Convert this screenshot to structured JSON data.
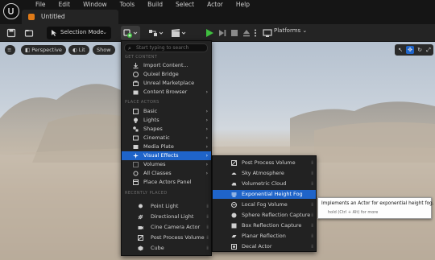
{
  "menubar": [
    "File",
    "Edit",
    "Window",
    "Tools",
    "Build",
    "Select",
    "Actor",
    "Help"
  ],
  "document_tab": "Untitled",
  "toolbar": {
    "mode_label": "Selection Mode",
    "platforms_label": "Platforms"
  },
  "viewport": {
    "perspective": "Perspective",
    "lit": "Lit",
    "show": "Show"
  },
  "add_menu": {
    "search_placeholder": "Start typing to search",
    "sections": {
      "get_content": "GET CONTENT",
      "place_actors": "PLACE ACTORS",
      "recently_placed": "RECENTLY PLACED"
    },
    "get_content": [
      "Import Content...",
      "Quixel Bridge",
      "Unreal Marketplace",
      "Content Browser"
    ],
    "place_actors": [
      "Basic",
      "Lights",
      "Shapes",
      "Cinematic",
      "Media Plate",
      "Visual Effects",
      "Volumes",
      "All Classes",
      "Place Actors Panel"
    ],
    "recently_placed": [
      "Point Light",
      "Directional Light",
      "Cine Camera Actor",
      "Post Process Volume",
      "Cube"
    ]
  },
  "visual_effects_menu": [
    "Post Process Volume",
    "Sky Atmosphere",
    "Volumetric Cloud",
    "Exponential Height Fog",
    "Local Fog Volume",
    "Sphere Reflection Capture",
    "Box Reflection Capture",
    "Planar Reflection",
    "Decal Actor"
  ],
  "tooltip": {
    "line1": "Implements an Actor for exponential height fog.",
    "line2": "hold (Ctrl + Alt) for more"
  },
  "colors": {
    "accent": "#1f64c9",
    "play_green": "#3fbf3f",
    "tab_orange": "#e07a17"
  }
}
